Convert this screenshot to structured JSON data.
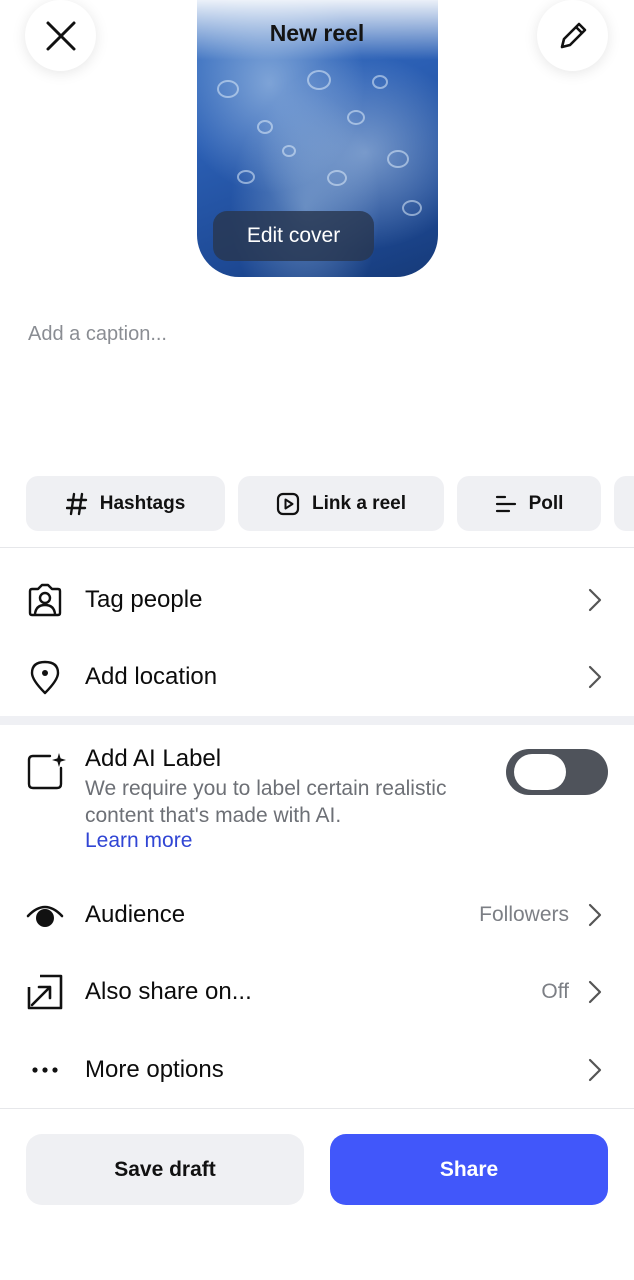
{
  "header": {
    "title": "New reel",
    "edit_cover_label": "Edit cover"
  },
  "caption": {
    "placeholder": "Add a caption..."
  },
  "chips": [
    {
      "label": "Hashtags"
    },
    {
      "label": "Link a reel"
    },
    {
      "label": "Poll"
    }
  ],
  "rows": {
    "tag_people": "Tag people",
    "add_location": "Add location"
  },
  "ai_label": {
    "title": "Add AI Label",
    "description": "We require you to label certain realistic content that's made with AI.",
    "learn_more": "Learn more",
    "toggle_on": false
  },
  "audience": {
    "label": "Audience",
    "value": "Followers"
  },
  "also_share": {
    "label": "Also share on...",
    "value": "Off"
  },
  "more_options": {
    "label": "More options"
  },
  "footer": {
    "save_draft": "Save draft",
    "share": "Share"
  },
  "colors": {
    "accent": "#4157fa",
    "link": "#3045d4",
    "chip_bg": "#eff0f3",
    "toggle_off": "#4f535b"
  }
}
